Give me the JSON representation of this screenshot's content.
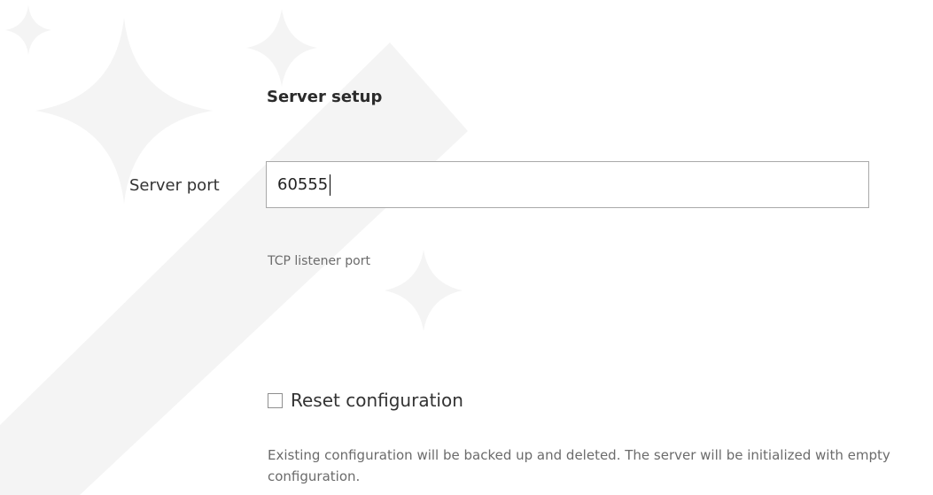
{
  "section": {
    "title": "Server setup"
  },
  "server_port": {
    "label": "Server port",
    "value": "60555",
    "hint": "TCP listener port"
  },
  "reset": {
    "label": "Reset configuration",
    "checked": false,
    "description": "Existing configuration will be backed up and deleted. The server will be initialized with empty configuration."
  },
  "colors": {
    "background": "#ffffff",
    "text": "#333333",
    "muted_text": "#6b6b6b",
    "input_border": "#a9a9a9",
    "watermark": "#f4f4f4"
  },
  "icons": {
    "watermark": "sparkle-wand-icon"
  }
}
